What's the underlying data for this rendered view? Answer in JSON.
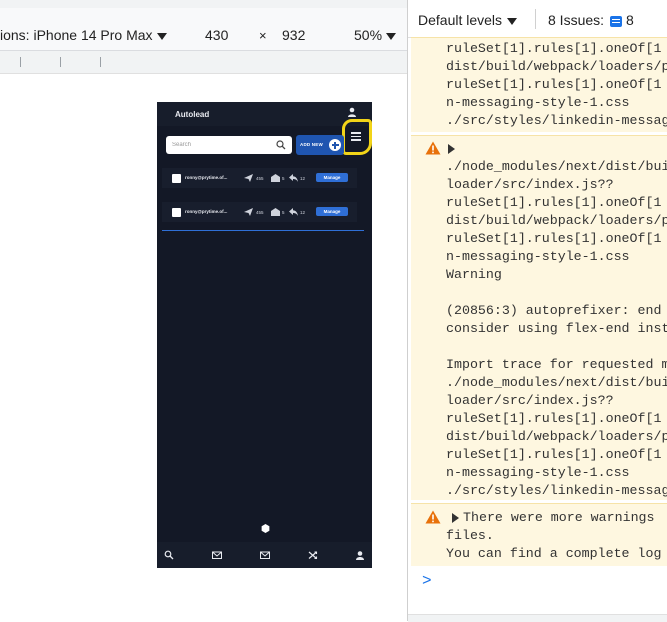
{
  "device_toolbar": {
    "device_label": "ions: iPhone 14 Pro Max",
    "width": "430",
    "times": "×",
    "height": "932",
    "zoom": "50%"
  },
  "app": {
    "title": "Autolead",
    "search": {
      "placeholder": "Search"
    },
    "add_button_label": "ADD NEW",
    "rows": [
      {
        "email": "ronny@prytime.of...",
        "sent": "455",
        "opened": "5",
        "replied": "12",
        "manage": "Manage"
      },
      {
        "email": "ronny@prytime.of...",
        "sent": "455",
        "opened": "5",
        "replied": "12",
        "manage": "Manage"
      }
    ],
    "accent_color": "#1f55b0",
    "annotation_color": "#f2d418"
  },
  "console": {
    "levels_label": "Default levels",
    "issues_label": "8 Issues:",
    "issues_count": "8",
    "block1": [
      "ruleSet[1].rules[1].oneOf[1",
      "dist/build/webpack/loaders/p",
      "ruleSet[1].rules[1].oneOf[1",
      "n-messaging-style-1.css",
      "./src/styles/linkedin-messag"
    ],
    "block2": [
      "./node_modules/next/dist/bui",
      "loader/src/index.js??",
      "ruleSet[1].rules[1].oneOf[1",
      "dist/build/webpack/loaders/p",
      "ruleSet[1].rules[1].oneOf[1",
      "n-messaging-style-1.css",
      "Warning",
      "",
      "(20856:3) autoprefixer: end",
      "consider using flex-end inst",
      "",
      "Import trace for requested m",
      "./node_modules/next/dist/bui",
      "loader/src/index.js??",
      "ruleSet[1].rules[1].oneOf[1",
      "dist/build/webpack/loaders/p",
      "ruleSet[1].rules[1].oneOf[1",
      "n-messaging-style-1.css",
      "./src/styles/linkedin-messag"
    ],
    "block3": [
      "There were more warnings",
      "files.",
      "You can find a complete log"
    ],
    "prompt": ">",
    "warning_color": "#e8710a"
  }
}
